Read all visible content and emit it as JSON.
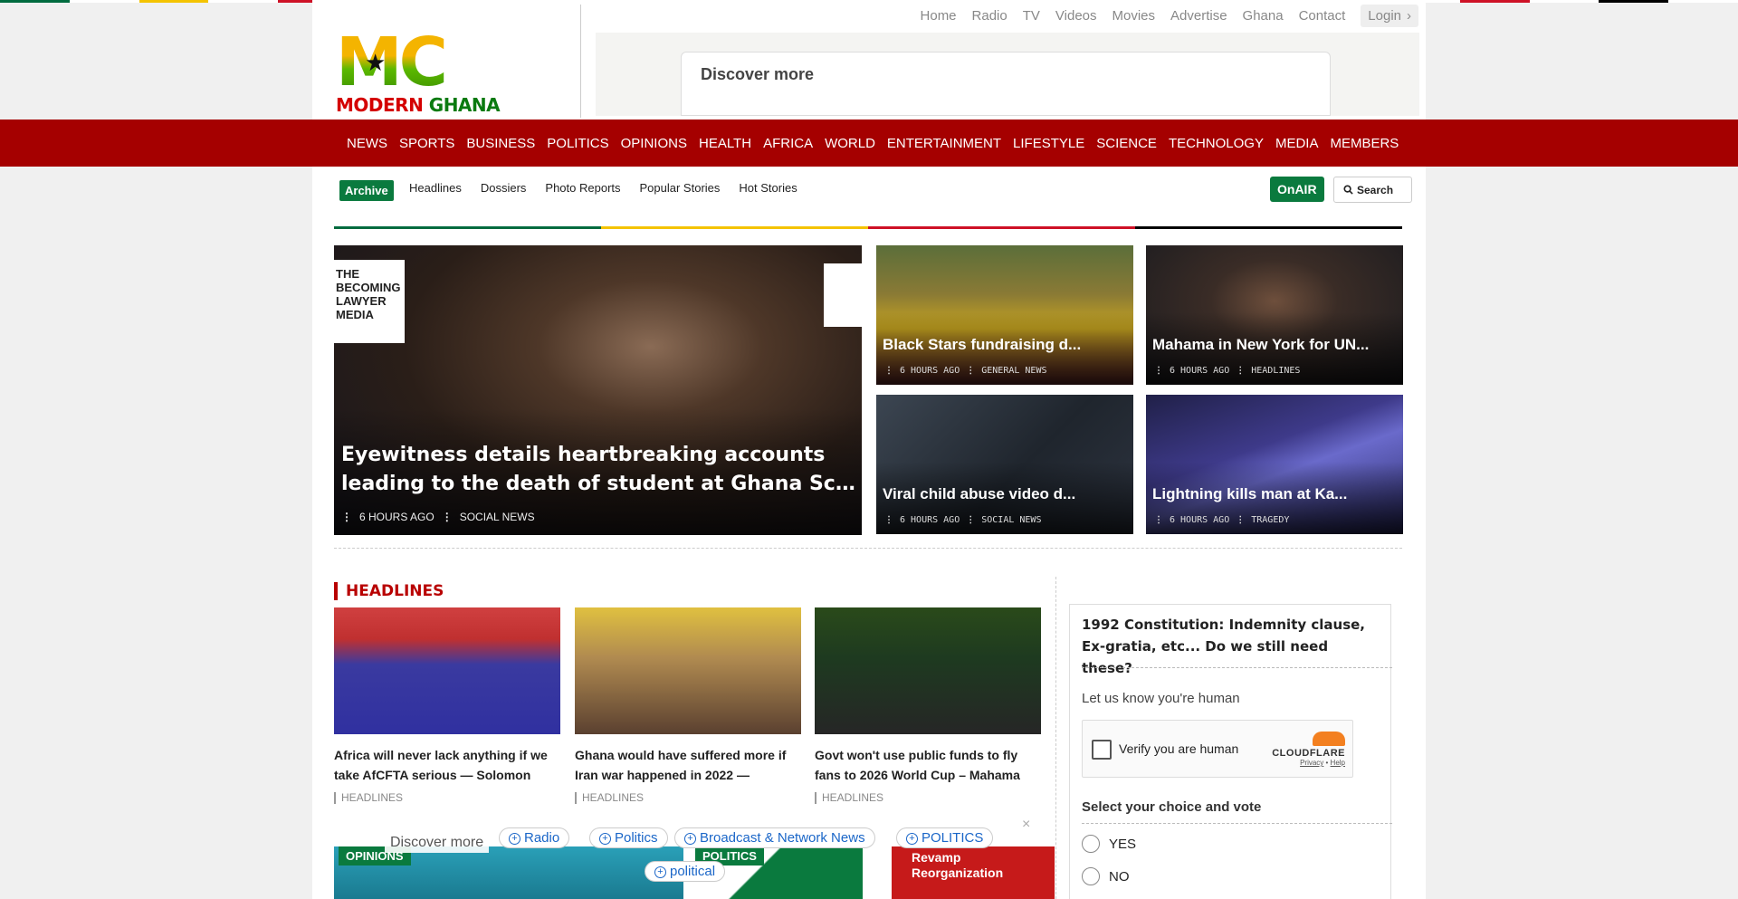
{
  "colors": {
    "brand_red": "#a50000",
    "brand_green": "#0a7a3e",
    "ghana_yellow": "#f4c300",
    "ghana_red": "#ce1126",
    "ghana_green": "#006b3f",
    "black": "#000000"
  },
  "logo": {
    "mark": "MC",
    "word1": "MODERN",
    "word2": "GHANA"
  },
  "top_nav": {
    "items": [
      "Home",
      "Radio",
      "TV",
      "Videos",
      "Movies",
      "Advertise",
      "Ghana",
      "Contact"
    ],
    "login": "Login"
  },
  "ad": {
    "discover": "Discover more"
  },
  "main_nav": {
    "items": [
      "NEWS",
      "SPORTS",
      "BUSINESS",
      "POLITICS",
      "OPINIONS",
      "HEALTH",
      "AFRICA",
      "WORLD",
      "ENTERTAINMENT",
      "LIFESTYLE",
      "SCIENCE",
      "TECHNOLOGY",
      "MEDIA",
      "MEMBERS"
    ]
  },
  "sub_nav": {
    "archive": "Archive",
    "items": [
      "Headlines",
      "Dossiers",
      "Photo Reports",
      "Popular Stories",
      "Hot Stories"
    ],
    "onair": "OnAIR",
    "search": "Search"
  },
  "hero": {
    "badge_text": "THE\nBECOMING\nLAWYER\nMEDIA\n(Projecting the Law)",
    "title_line1": "Eyewitness details heartbreaking accounts",
    "title_line2": "leading to the death of student at Ghana School ...",
    "time": "6 HOURS AGO",
    "category": "SOCIAL NEWS"
  },
  "cards": [
    {
      "title": "Black Stars fundraising d...",
      "time": "6 HOURS AGO",
      "category": "GENERAL NEWS"
    },
    {
      "title": "Mahama in New York for UN...",
      "time": "6 HOURS AGO",
      "category": "HEADLINES"
    },
    {
      "title": "Viral child abuse video d...",
      "time": "6 HOURS AGO",
      "category": "SOCIAL NEWS"
    },
    {
      "title": "Lightning kills man at Ka...",
      "time": "6 HOURS AGO",
      "category": "TRAGEDY"
    }
  ],
  "headlines": {
    "section_title": "HEADLINES",
    "items": [
      {
        "title": "Africa will never lack anything if we take AfCFTA serious — Solomon",
        "category": "HEADLINES"
      },
      {
        "title": "Ghana would have suffered more if Iran war happened in 2022 —",
        "category": "HEADLINES"
      },
      {
        "title": "Govt won't use public funds to fly fans to 2026 World Cup – Mahama",
        "category": "HEADLINES"
      }
    ]
  },
  "bottom_row": {
    "tag1": "OPINIONS",
    "tag2": "POLITICS",
    "revamp_line1": "Revamp",
    "revamp_line2": "Reorganization"
  },
  "discover_bar": {
    "label": "Discover more",
    "chips": [
      "Radio",
      "Politics",
      "Broadcast & Network News",
      "POLITICS",
      "political"
    ],
    "close": "×"
  },
  "poll": {
    "question": "1992 Constitution: Indemnity clause, Ex-gratia, etc... Do we still need these?",
    "human_prompt": "Let us know you're human",
    "captcha_label": "Verify you are human",
    "captcha_brand": "CLOUDFLARE",
    "captcha_privacy": "Privacy",
    "captcha_help": "Help",
    "select_prompt": "Select your choice and vote",
    "options": [
      "YES",
      "NO"
    ]
  }
}
